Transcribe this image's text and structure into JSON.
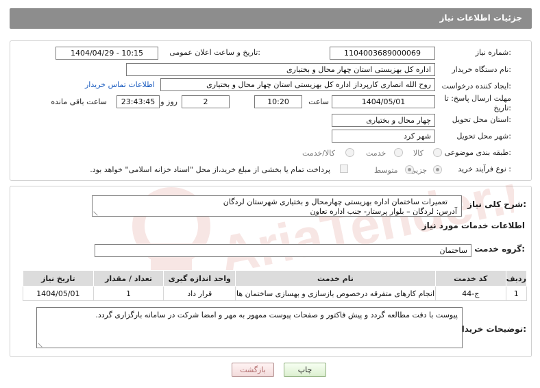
{
  "header": {
    "title": "جزئیات اطلاعات نیاز"
  },
  "form": {
    "need_number_label": "شماره نیاز:",
    "need_number": "1104003689000069",
    "announce_label": "تاریخ و ساعت اعلان عمومی:",
    "announce_value": "1404/04/29 - 10:15",
    "buyer_org_label": "نام دستگاه خریدار:",
    "buyer_org": "اداره کل بهزیستی استان چهار محال و بختیاری",
    "requester_label": "ایجاد کننده درخواست:",
    "requester": "روح الله انصاری کارپرداز اداره کل بهزیستی استان چهار محال و بختیاری",
    "contact_link": "اطلاعات تماس خریدار",
    "deadline_label_1": "مهلت ارسال پاسخ: تا",
    "deadline_label_2": "تاریخ:",
    "deadline_date": "1404/05/01",
    "time_label": "ساعت",
    "deadline_time": "10:20",
    "days_value": "2",
    "days_label": "روز و",
    "remaining_time": "23:43:45",
    "remaining_label": "ساعت باقی مانده",
    "province_label": "استان محل تحویل:",
    "province": "چهار محال و بختیاری",
    "city_label": "شهر محل تحویل:",
    "city": "شهر کرد",
    "category_label": "طبقه بندی موضوعی:",
    "category_options": [
      "کالا",
      "خدمت",
      "کالا/خدمت"
    ],
    "process_label": "نوع فرآیند خرید :",
    "process_options": [
      "جزیی",
      "متوسط"
    ],
    "payment_note": "پرداخت تمام یا بخشی از مبلغ خرید،از محل \"اسناد خزانه اسلامی\" خواهد بود."
  },
  "description": {
    "label": "شرح کلی نیاز:",
    "line1": "تعمیرات ساختمان اداره بهزیستی  چهارمحال و بختیاری شهرستان لردگان",
    "line2": "آدرس: لردگان – بلوار پرستار- جنب اداره تعاون"
  },
  "services": {
    "section_title": "اطلاعات خدمات مورد نیاز",
    "group_label": "گروه خدمت:",
    "group_value": "ساختمان",
    "columns": [
      "ردیف",
      "کد خدمت",
      "نام خدمت",
      "واحد اندازه گیری",
      "تعداد / مقدار",
      "تاریخ نیاز"
    ],
    "rows": [
      [
        "1",
        "ج-44",
        "انجام کارهای متفرقه درخصوص بازسازی و بهسازی ساختمان ها",
        "قرار داد",
        "1",
        "1404/05/01"
      ]
    ]
  },
  "buyer_notes": {
    "label": "توضیحات خریدار:",
    "text": "پیوست با دقت مطالعه گردد و پیش فاکتور و صفحات پیوست ممهور به مهر و امضا شرکت در سامانه بارگزاری گردد."
  },
  "actions": {
    "print_label": "چاپ",
    "back_label": "بازگشت"
  },
  "watermark": {
    "text": "AriaTender.net"
  },
  "colors": {
    "header": "#8d8d8d",
    "link": "#1a5bbf",
    "watermark": "#c0392b"
  }
}
